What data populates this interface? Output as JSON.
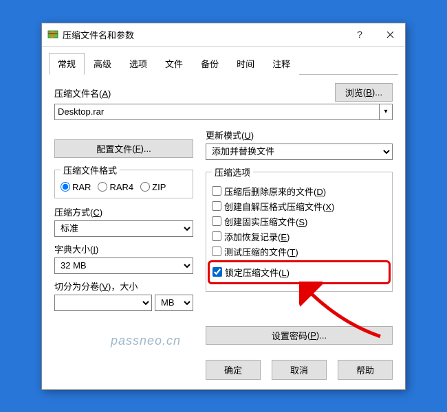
{
  "window": {
    "title": "压缩文件名和参数"
  },
  "tabs": [
    "常规",
    "高级",
    "选项",
    "文件",
    "备份",
    "时间",
    "注释"
  ],
  "labels": {
    "filename": "压缩文件名",
    "filename_key": "A",
    "browse": "浏览",
    "browse_key": "B",
    "profile": "配置文件",
    "profile_key": "F",
    "update_mode": "更新模式",
    "update_mode_key": "U",
    "format_group": "压缩文件格式",
    "method": "压缩方式",
    "method_key": "C",
    "dict": "字典大小",
    "dict_key": "I",
    "split": "切分为分卷",
    "split_key": "V",
    "split_suffix": "，大小",
    "options_group": "压缩选项",
    "password": "设置密码",
    "password_key": "P"
  },
  "filename_value": "Desktop.rar",
  "update_mode_value": "添加并替换文件",
  "formats": {
    "rar": "RAR",
    "rar4": "RAR4",
    "zip": "ZIP"
  },
  "method_value": "标准",
  "dict_value": "32 MB",
  "split_unit": "MB",
  "options": {
    "delete_after": {
      "label": "压缩后删除原来的文件",
      "key": "D"
    },
    "create_sfx": {
      "label": "创建自解压格式压缩文件",
      "key": "X"
    },
    "create_solid": {
      "label": "创建固实压缩文件",
      "key": "S"
    },
    "add_recovery": {
      "label": "添加恢复记录",
      "key": "E"
    },
    "test_files": {
      "label": "测试压缩的文件",
      "key": "T"
    },
    "lock_archive": {
      "label": "锁定压缩文件",
      "key": "L"
    }
  },
  "buttons": {
    "ok": "确定",
    "cancel": "取消",
    "help": "帮助"
  },
  "watermark": "passneo.cn"
}
